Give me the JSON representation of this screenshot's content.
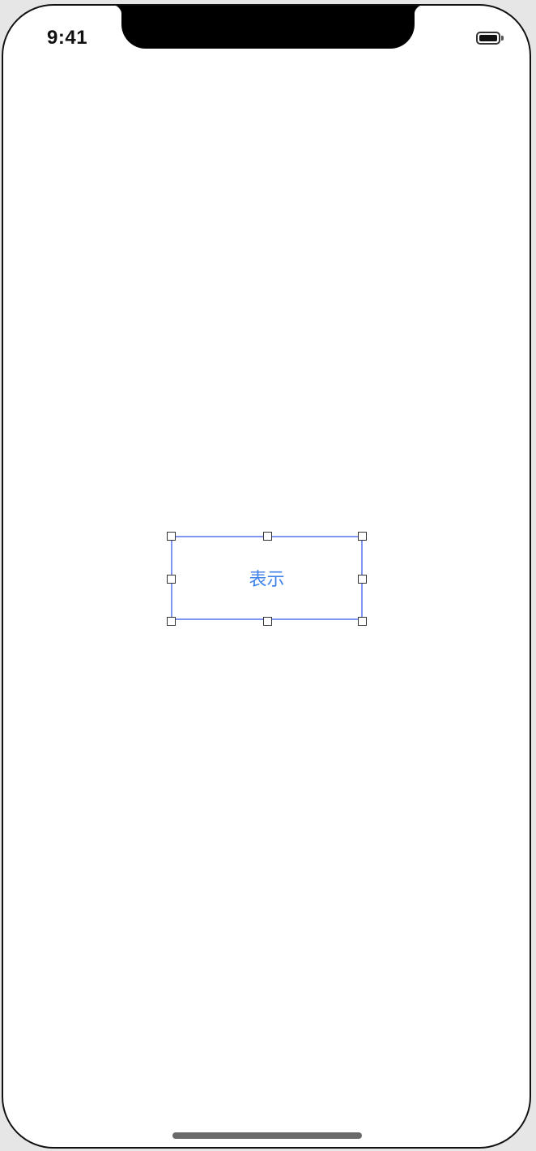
{
  "status_bar": {
    "time": "9:41",
    "battery_icon": "battery-full-icon"
  },
  "main": {
    "button_label": "表示",
    "selected": true
  },
  "colors": {
    "button_text": "#3e82e8",
    "selection_border": "#7f95f0",
    "background": "#ffffff"
  }
}
